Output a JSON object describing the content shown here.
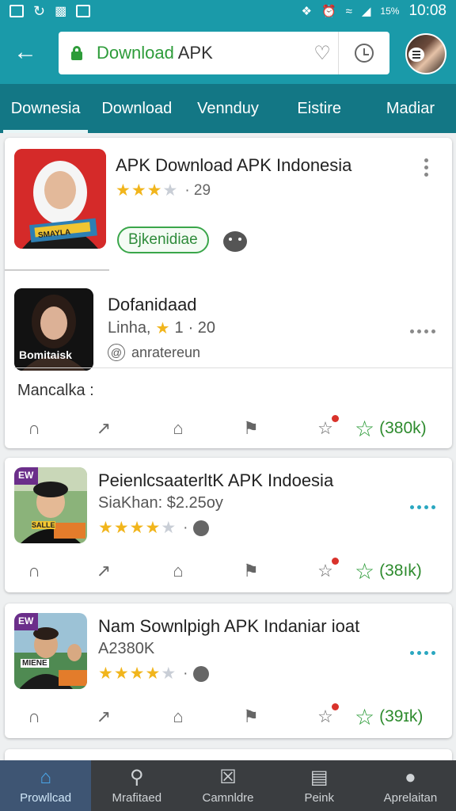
{
  "status_bar": {
    "time": "10:08",
    "battery": "15%"
  },
  "app_bar": {
    "url_green": "Download ",
    "url_dark": "APK"
  },
  "tabs": [
    {
      "label": "Downesia"
    },
    {
      "label": "Download"
    },
    {
      "label": "Vennduy"
    },
    {
      "label": "Eistire"
    },
    {
      "label": "Madiar"
    }
  ],
  "cards": [
    {
      "title": "APK Download APK Indonesia",
      "rating_text": "· 29",
      "pill": "Bjkenidiae",
      "thumb_caption": "SMAYLA"
    },
    {
      "title": "Dofanidaad",
      "subtitle_prefix": "Linha,",
      "rating_value": "1",
      "rating_extra": "· 20",
      "handle": "anratereun",
      "thumb_caption": "Bomitaisk",
      "section_label": "Mancalka :",
      "fav_count": "(380k)"
    },
    {
      "title": "PeienlcsaaterltK APK  Indoesia",
      "subtitle": "SiaKhan:  $2.25oy",
      "fav_count": "(38ık)",
      "thumb_caption": "SALLE",
      "thumb_badge": "EW"
    },
    {
      "title": "Nam Sownlpigh APK Indaniar ioat",
      "subtitle": "A2380K",
      "fav_count": "(39ɪk)",
      "thumb_caption": "MIENE",
      "thumb_badge": "EW"
    }
  ],
  "bottom_nav": [
    {
      "label": "Prowllcad",
      "icon": "home-icon"
    },
    {
      "label": "Mrafitaed",
      "icon": "search-icon"
    },
    {
      "label": "Camnldre",
      "icon": "close-box-icon"
    },
    {
      "label": "Peink",
      "icon": "book-icon"
    },
    {
      "label": "Aprelaitan",
      "icon": "person-icon"
    }
  ],
  "colors": {
    "toolbar": "#1a9aa9",
    "tabs": "#137785",
    "star_on": "#f1b51c",
    "favorite_green": "#2e9c3a",
    "bottom_nav": "#3a3d40"
  }
}
